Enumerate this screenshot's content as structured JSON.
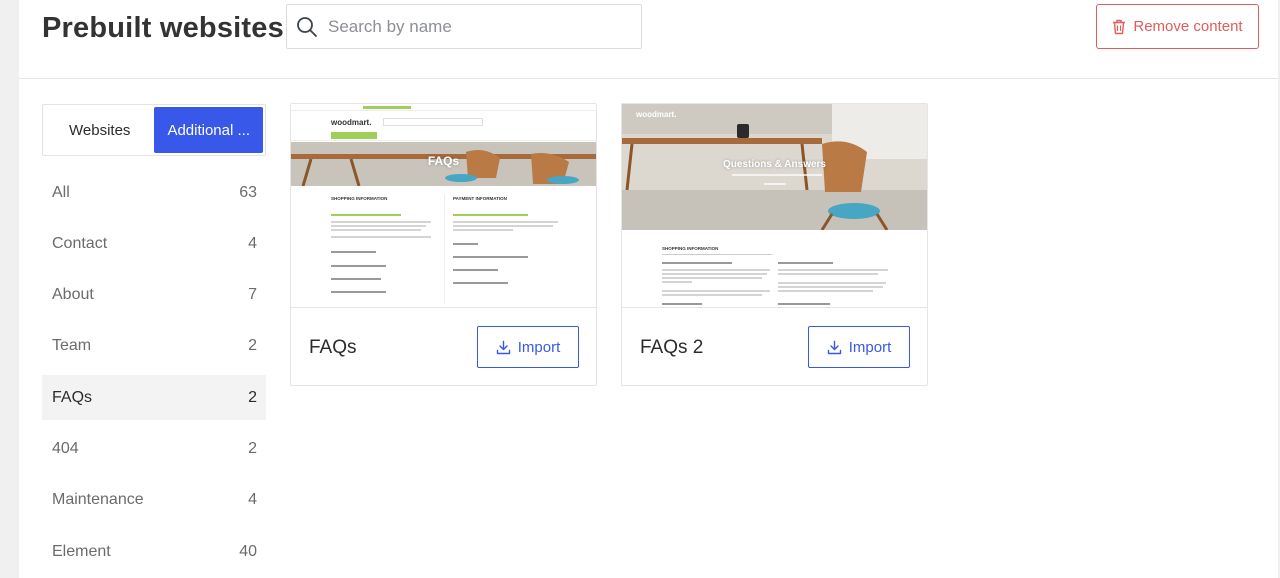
{
  "header": {
    "title": "Prebuilt websites",
    "search_placeholder": "Search by name",
    "remove_label": "Remove content"
  },
  "tabs": {
    "websites_label": "Websites",
    "additional_label": "Additional ...",
    "active": "additional"
  },
  "categories": [
    {
      "label": "All",
      "count": "63"
    },
    {
      "label": "Contact",
      "count": "4"
    },
    {
      "label": "About",
      "count": "7"
    },
    {
      "label": "Team",
      "count": "2"
    },
    {
      "label": "FAQs",
      "count": "2",
      "active": true
    },
    {
      "label": "404",
      "count": "2"
    },
    {
      "label": "Maintenance",
      "count": "4"
    },
    {
      "label": "Element",
      "count": "40"
    }
  ],
  "cards": [
    {
      "name": "FAQs",
      "import_label": "Import",
      "thumb": {
        "logo": "woodmart.",
        "hero_title": "FAQs",
        "col1_heading": "SHOPPING INFORMATION",
        "col2_heading": "PAYMENT INFORMATION"
      }
    },
    {
      "name": "FAQs 2",
      "import_label": "Import",
      "thumb": {
        "logo": "woodmart.",
        "hero_title": "Questions & Answers",
        "col1_heading": "SHOPPING INFORMATION"
      }
    }
  ],
  "colors": {
    "accent": "#3858e9",
    "danger": "#e35b5b",
    "brand_green": "#9fcf57"
  },
  "icons": {
    "search": "search-icon",
    "trash": "trash-icon",
    "download": "download-icon"
  }
}
